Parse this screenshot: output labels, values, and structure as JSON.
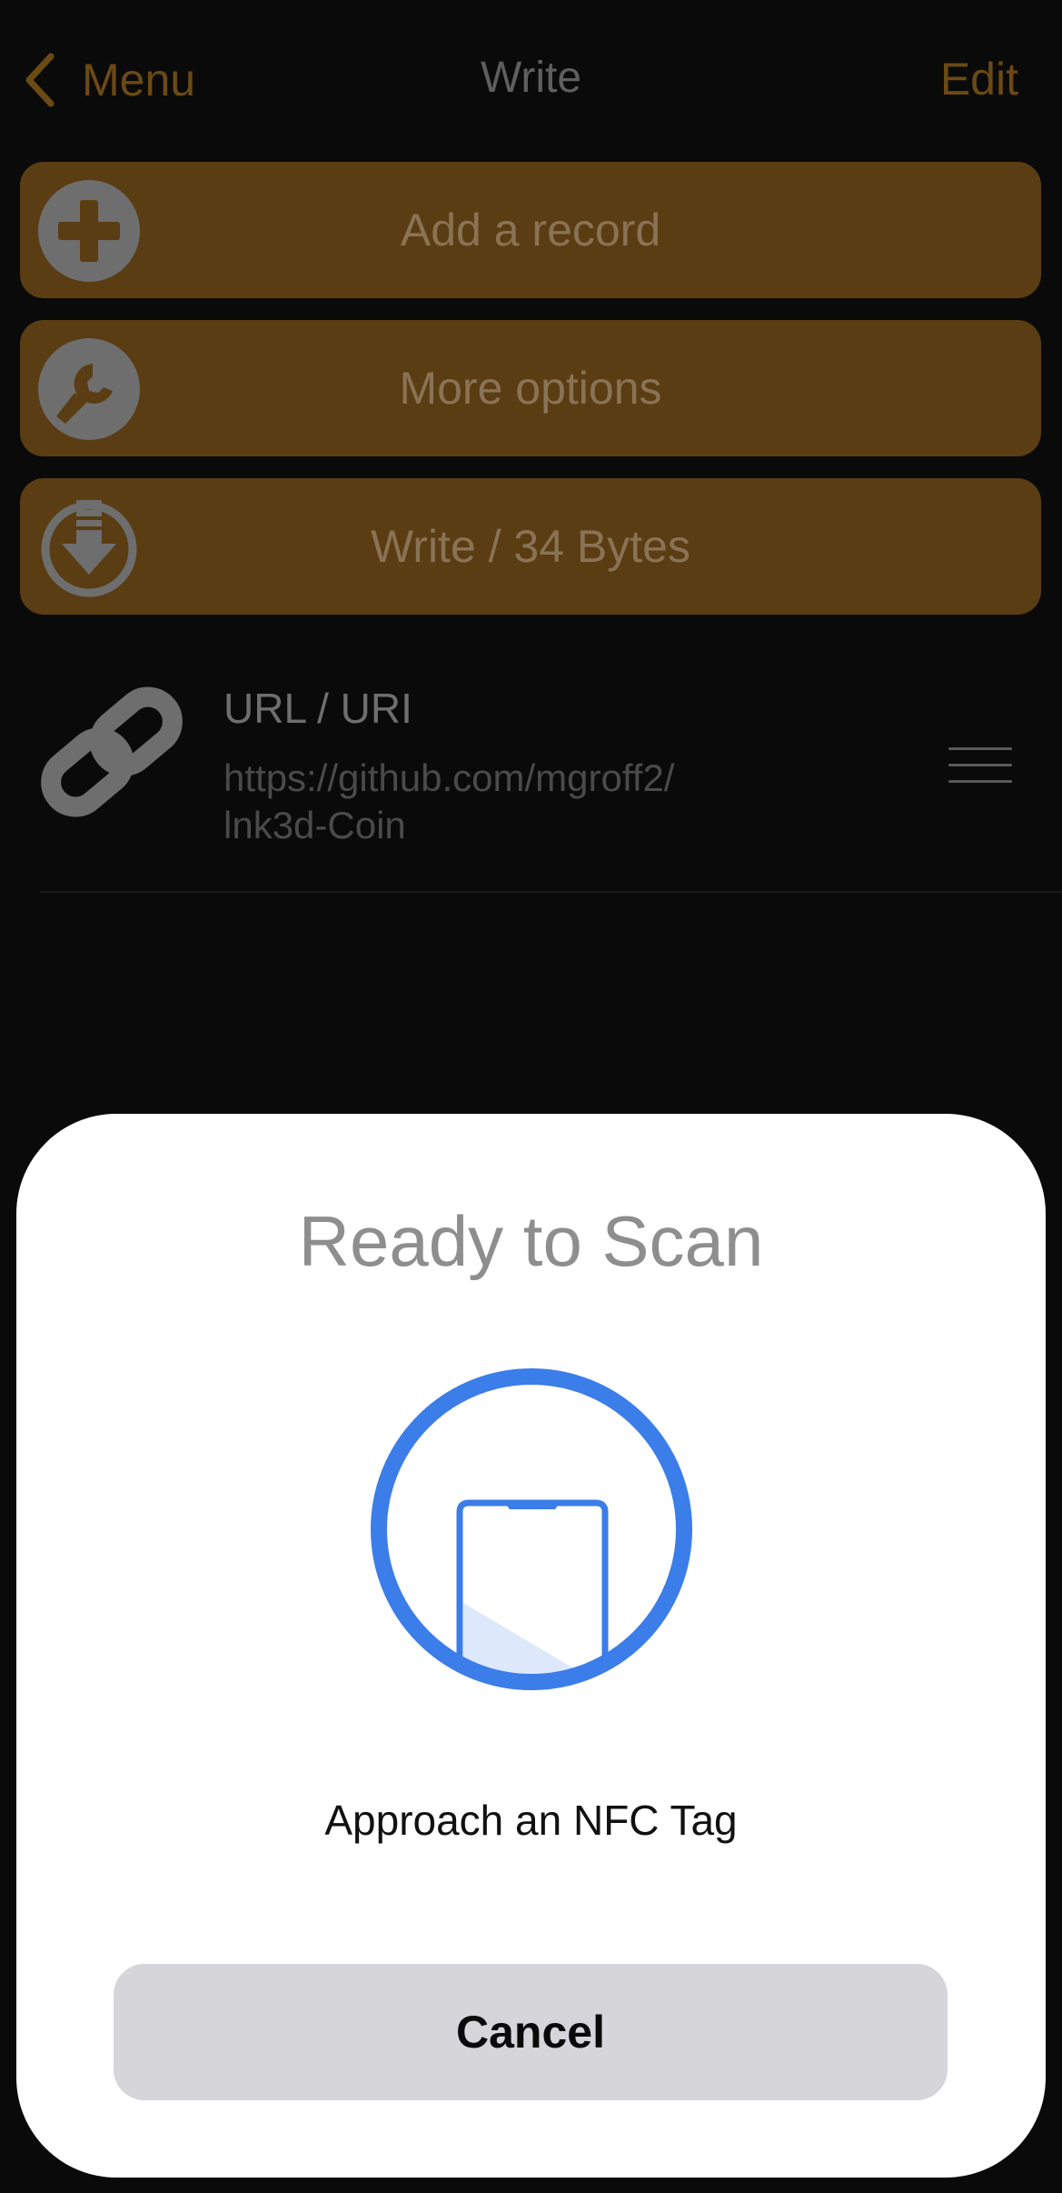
{
  "nav": {
    "back_label": "Menu",
    "title": "Write",
    "edit_label": "Edit"
  },
  "actions": {
    "add_record": {
      "label": "Add a record",
      "icon": "plus-circle-icon"
    },
    "more_options": {
      "label": "More options",
      "icon": "wrench-circle-icon"
    },
    "write": {
      "label": "Write / 34 Bytes",
      "icon": "download-circle-icon"
    }
  },
  "record": {
    "type": "URL / URI",
    "value": "https://github.com/mgroff2/lnk3d-Coin",
    "value_lines": [
      "https://github.com/mgroff2/",
      "lnk3d-Coin"
    ],
    "icon": "link-icon"
  },
  "nfc_sheet": {
    "title": "Ready to Scan",
    "message": "Approach an NFC Tag",
    "cancel_label": "Cancel",
    "icon": "phone-scan-icon"
  },
  "colors": {
    "background": "#0a0a0a",
    "accent": "#6b4a14",
    "button_bg": "#5a3d13",
    "scan_blue": "#3b7de9",
    "cancel_bg": "#d5d5da"
  }
}
